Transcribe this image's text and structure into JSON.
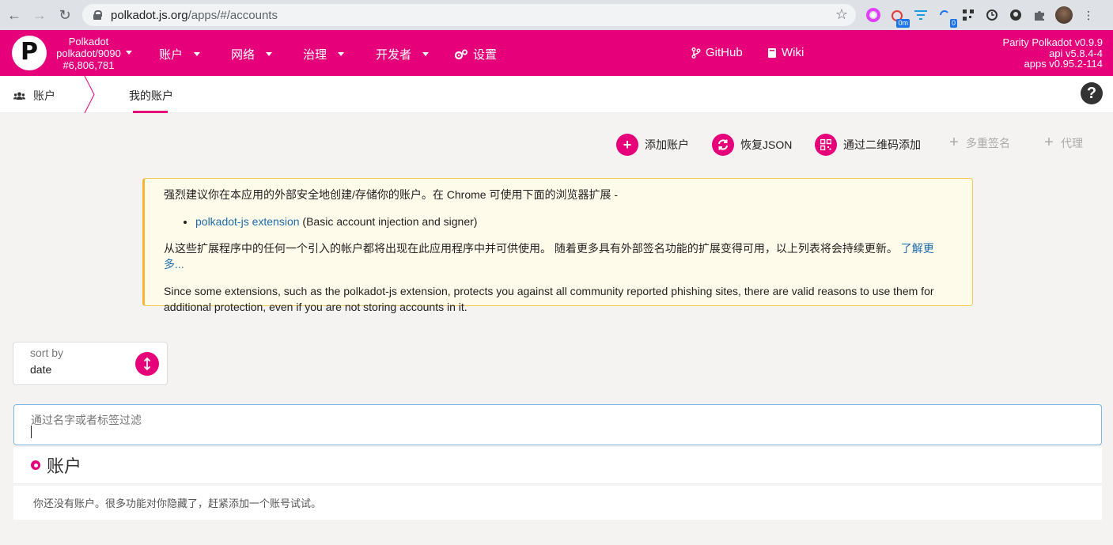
{
  "browser": {
    "url_host": "polkadot.js.org",
    "url_path": "/apps/#/accounts",
    "ext_badges": [
      "0m",
      "0"
    ]
  },
  "header": {
    "chain_name": "Polkadot",
    "endpoint": "polkadot/9090",
    "block": "#6,806,781",
    "menu": [
      {
        "label": "账户"
      },
      {
        "label": "网络"
      },
      {
        "label": "治理"
      },
      {
        "label": "开发者"
      },
      {
        "label": "设置"
      }
    ],
    "github": "GitHub",
    "wiki": "Wiki",
    "versions": [
      "Parity Polkadot v0.9.9",
      "api v5.8.4-4",
      "apps v0.95.2-114"
    ]
  },
  "subnav": {
    "section": "账户",
    "tab_active": "我的账户",
    "help": "?"
  },
  "actions": {
    "add_account": "添加账户",
    "restore_json": "恢复JSON",
    "add_qr": "通过二维码添加",
    "multisig": "多重签名",
    "proxy": "代理"
  },
  "notice": {
    "line1": "强烈建议你在本应用的外部安全地创建/存储你的账户。在 Chrome 可使用下面的浏览器扩展 -",
    "ext_link": "polkadot-js extension",
    "ext_desc": " (Basic account injection and signer)",
    "line2": "从这些扩展程序中的任何一个引入的帐户都将出现在此应用程序中并可供使用。 随着更多具有外部签名功能的扩展变得可用，以上列表将会持续更新。 ",
    "learn_more": "了解更多...",
    "line3": "Since some extensions, such as the polkadot-js extension, protects you against all community reported phishing sites, there are valid reasons to use them for additional protection, even if you are not storing accounts in it."
  },
  "sort": {
    "label": "sort by",
    "value": "date"
  },
  "filter": {
    "label": "通过名字或者标签过滤",
    "value": ""
  },
  "accounts": {
    "title": "账户",
    "empty": "你还没有账户。很多功能对你隐藏了，赶紧添加一个账号试试。"
  },
  "colors": {
    "accent": "#e6007a",
    "notice_bg": "#fffbea",
    "notice_border": "#f2b632",
    "link": "#1c6cad"
  }
}
